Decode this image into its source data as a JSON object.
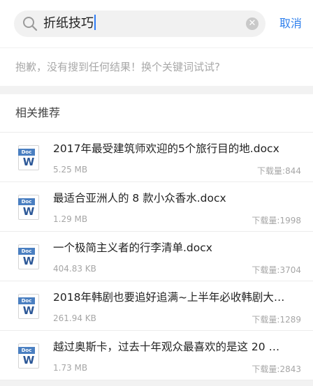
{
  "search": {
    "query": "折纸技巧",
    "cancel_label": "取消"
  },
  "empty_message": "抱歉，没有搜到任何结果！换个关键词试试?",
  "recommend_header": "相关推荐",
  "doc_badge": "Doc",
  "doc_letter": "W",
  "items": [
    {
      "title": "2017年最受建筑师欢迎的5个旅行目的地.docx",
      "size": "5.25 MB",
      "downloads": "下载量:844"
    },
    {
      "title": "最适合亚洲人的 8 款小众香水.docx",
      "size": "1.29 MB",
      "downloads": "下载量:1998"
    },
    {
      "title": "一个极简主义者的行李清单.docx",
      "size": "404.83 KB",
      "downloads": "下载量:3704"
    },
    {
      "title": "2018年韩剧也要追好追满~上半年必收韩剧大…",
      "size": "261.94 KB",
      "downloads": "下载量:1289"
    },
    {
      "title": "越过奥斯卡，过去十年观众最喜欢的是这 20 …",
      "size": "1.73 MB",
      "downloads": "下载量:2843"
    }
  ]
}
